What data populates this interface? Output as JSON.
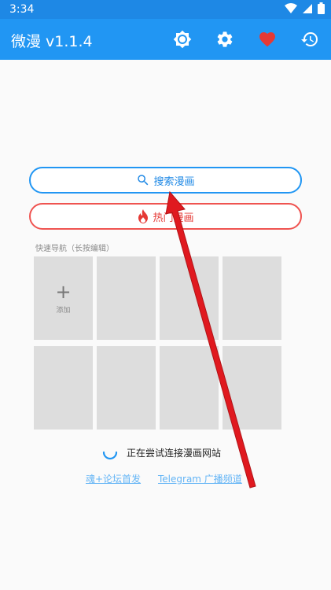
{
  "status_bar": {
    "time": "3:34",
    "icons": [
      "wifi-icon",
      "signal-icon",
      "battery-icon"
    ]
  },
  "app_bar": {
    "title": "微漫 v1.1.4",
    "actions": [
      "theme-brightness-icon",
      "settings-gear-icon",
      "favorites-heart-icon",
      "history-icon"
    ],
    "bar_color": "#2196f3",
    "heart_color": "#e53935"
  },
  "main": {
    "search_button_label": "搜索漫画",
    "hot_button_label": "热门漫画",
    "quick_nav_caption": "快速导航（长按编辑）",
    "grid_add_label": "添加",
    "grid_add_symbol": "+",
    "loading_text": "正在尝试连接漫画网站",
    "links": [
      "魂+论坛首发",
      "Telegram 广播频道"
    ]
  },
  "colors": {
    "search_accent": "#2196f3",
    "hot_accent": "#e53935",
    "link": "#64b5f6",
    "arrow": "#e0191f"
  }
}
